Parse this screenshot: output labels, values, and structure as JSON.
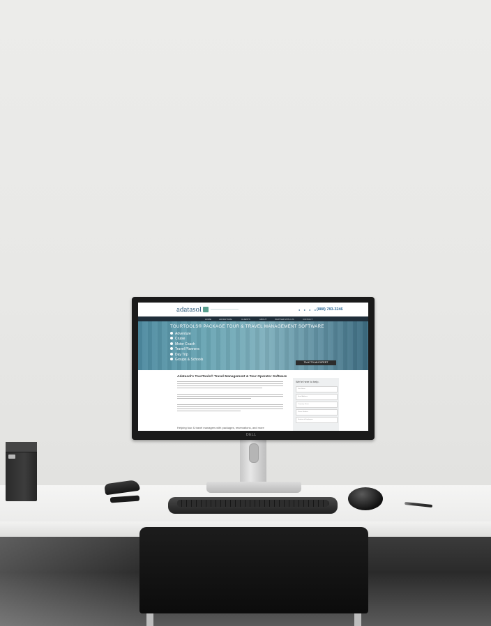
{
  "scene": {
    "monitor_brand": "DELL"
  },
  "website": {
    "logo_text": "adatasol",
    "phone": "(888) 783-3246",
    "nav": [
      "HOME",
      "ADVENTURE",
      "CLIENTS",
      "ABOUT",
      "PARTNER WITH US",
      "CONTACT"
    ],
    "hero": {
      "title": "TOURTOOLS® PACKAGE TOUR & TRAVEL MANAGEMENT SOFTWARE",
      "items": [
        "Adventure",
        "Cruise",
        "Motor Coach",
        "Travel Planners",
        "Day Trip",
        "Groups & Schools"
      ],
      "cta": "TALK TO AN EXPERT"
    },
    "content_title": "Adatasol's TourTools® Travel Management & Tour Operator Software",
    "subtitle": "Helping tour & travel managers with packages, reservations, and more",
    "form": {
      "title": "We're here to help.",
      "fields": [
        "First Name",
        "Email Address",
        "Company Name",
        "Phone Number",
        "Number of Employees"
      ]
    }
  }
}
